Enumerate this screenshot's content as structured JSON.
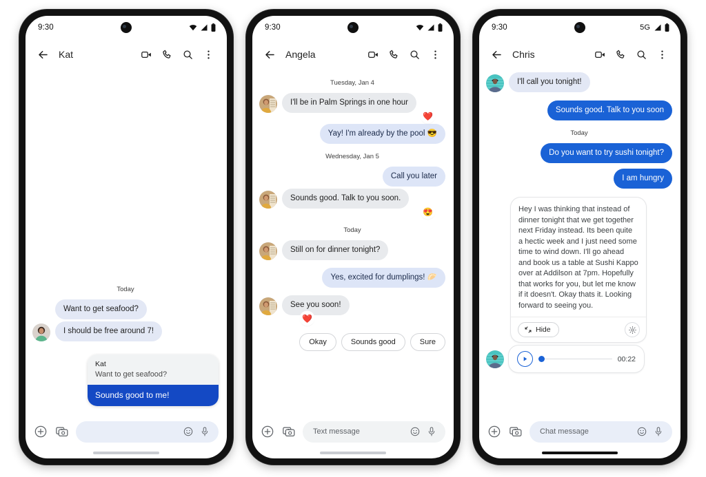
{
  "phones": [
    {
      "id": "phone-kat",
      "status": {
        "time": "9:30",
        "network": "",
        "wifi": "wifi-icon",
        "signal": "signal-icon",
        "battery": "battery-icon"
      },
      "appbar": {
        "back": "back-arrow-icon",
        "title": "Kat",
        "icons": [
          "video-call-icon",
          "phone-call-icon",
          "search-icon",
          "more-options-icon"
        ]
      },
      "thread": {
        "day_divider": "Today",
        "messages": [
          {
            "side": "in",
            "text": "Want to get seafood?",
            "style": "rcs",
            "avatar": false
          },
          {
            "side": "in",
            "text": "I should be free around 7!",
            "style": "rcs",
            "avatar": true
          }
        ],
        "reply_card": {
          "quoted_name": "Kat",
          "quoted_text": "Want to get seafood?",
          "answer": "Sounds good to me!"
        }
      },
      "composer": {
        "plus": "add-icon",
        "gallery": "gallery-camera-icon",
        "placeholder": "",
        "field_style": "blue",
        "emoji": "emoji-icon",
        "mic": "microphone-icon"
      }
    },
    {
      "id": "phone-angela",
      "status": {
        "time": "9:30",
        "network": "",
        "wifi": "wifi-icon",
        "signal": "signal-icon",
        "battery": "battery-icon"
      },
      "appbar": {
        "back": "back-arrow-icon",
        "title": "Angela",
        "icons": [
          "video-call-icon",
          "phone-call-icon",
          "search-icon",
          "more-options-icon"
        ]
      },
      "thread": {
        "items": [
          {
            "kind": "day",
            "text": "Tuesday, Jan 4"
          },
          {
            "kind": "msg",
            "side": "in",
            "text": "I'll be in Palm Springs in one hour",
            "avatar": true,
            "reaction": "❤️",
            "reaction_side": "out"
          },
          {
            "kind": "msg",
            "side": "out",
            "text": "Yay! I'm already by the pool 😎"
          },
          {
            "kind": "day",
            "text": "Wednesday, Jan 5"
          },
          {
            "kind": "msg",
            "side": "out",
            "text": "Call you later"
          },
          {
            "kind": "msg",
            "side": "in",
            "text": "Sounds good. Talk to you soon.",
            "avatar": true,
            "reaction": "😍",
            "reaction_side": "out"
          },
          {
            "kind": "day",
            "text": "Today"
          },
          {
            "kind": "msg",
            "side": "in",
            "text": "Still on for dinner tonight?",
            "avatar": true
          },
          {
            "kind": "msg",
            "side": "out",
            "text": "Yes, excited for dumplings! 🥟"
          },
          {
            "kind": "msg",
            "side": "in",
            "text": "See you soon!",
            "avatar": true,
            "reaction": "❤️",
            "reaction_side": "in"
          }
        ],
        "suggestions": [
          "Okay",
          "Sounds good",
          "Sure"
        ]
      },
      "composer": {
        "plus": "add-icon",
        "gallery": "gallery-camera-icon",
        "placeholder": "Text message",
        "field_style": "grey",
        "emoji": "emoji-icon",
        "mic": "microphone-icon"
      }
    },
    {
      "id": "phone-chris",
      "status": {
        "time": "9:30",
        "network": "5G",
        "wifi": "",
        "signal": "signal-icon",
        "battery": "battery-icon"
      },
      "appbar": {
        "back": "back-arrow-icon",
        "title": "Chris",
        "icons": [
          "video-call-icon",
          "phone-call-icon",
          "search-icon",
          "more-options-icon"
        ]
      },
      "thread": {
        "items": [
          {
            "kind": "msg",
            "side": "in",
            "text": "I'll call you tonight!",
            "avatar": true
          },
          {
            "kind": "msg",
            "side": "out",
            "text": "Sounds good. Talk to you soon"
          },
          {
            "kind": "day",
            "text": "Today"
          },
          {
            "kind": "msg",
            "side": "out",
            "text": "Do you want to try sushi tonight?"
          },
          {
            "kind": "msg",
            "side": "out",
            "text": "I am hungry"
          }
        ],
        "long_message": {
          "text": "Hey I was thinking that instead of dinner tonight that we get together next Friday instead. Its been quite a hectic week and I just need some time to wind down.  I'll go ahead and book us a table at Sushi Kappo over at Addilson at 7pm.  Hopefully that works for you, but let me know if it doesn't. Okay thats it. Looking forward to seeing you.",
          "hide_label": "Hide",
          "hide_icon": "collapse-icon",
          "settings_icon": "gear-icon"
        },
        "audio": {
          "play_icon": "play-icon",
          "duration": "00:22",
          "progress": 0
        }
      },
      "composer": {
        "plus": "add-icon",
        "gallery": "gallery-camera-icon",
        "placeholder": "Chat message",
        "field_style": "blue",
        "emoji": "emoji-icon",
        "mic": "microphone-icon"
      }
    }
  ],
  "colors": {
    "sent_blue": "#1a62d6",
    "sent_light": "#dde5f7",
    "received_grey": "#e8eaed",
    "received_rcs": "#e3e8f5",
    "reply_card_blue": "#1449c4",
    "frame": "#121212"
  }
}
